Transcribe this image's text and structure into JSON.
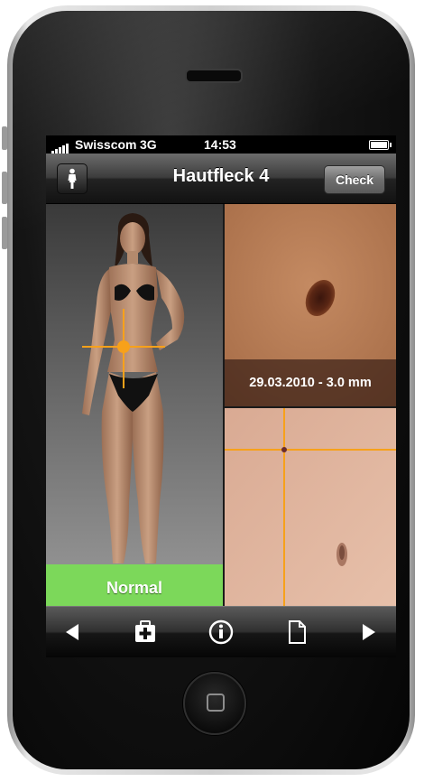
{
  "status_bar": {
    "carrier": "Swisscom",
    "network": "3G",
    "time": "14:53"
  },
  "nav": {
    "title": "Hautfleck 4",
    "check_label": "Check",
    "body_icon": "female-figure-icon"
  },
  "body_view": {
    "status": "Normal"
  },
  "closeup": {
    "caption": "29.03.2010 - 3.0 mm"
  },
  "toolbar": {
    "items": [
      "previous-arrow-icon",
      "first-aid-kit-icon",
      "info-icon",
      "document-icon",
      "next-arrow-icon"
    ]
  },
  "colors": {
    "status_normal": "#7cd85a",
    "crosshair": "#f7a11a",
    "nav_dark": "#1a1a1a"
  }
}
